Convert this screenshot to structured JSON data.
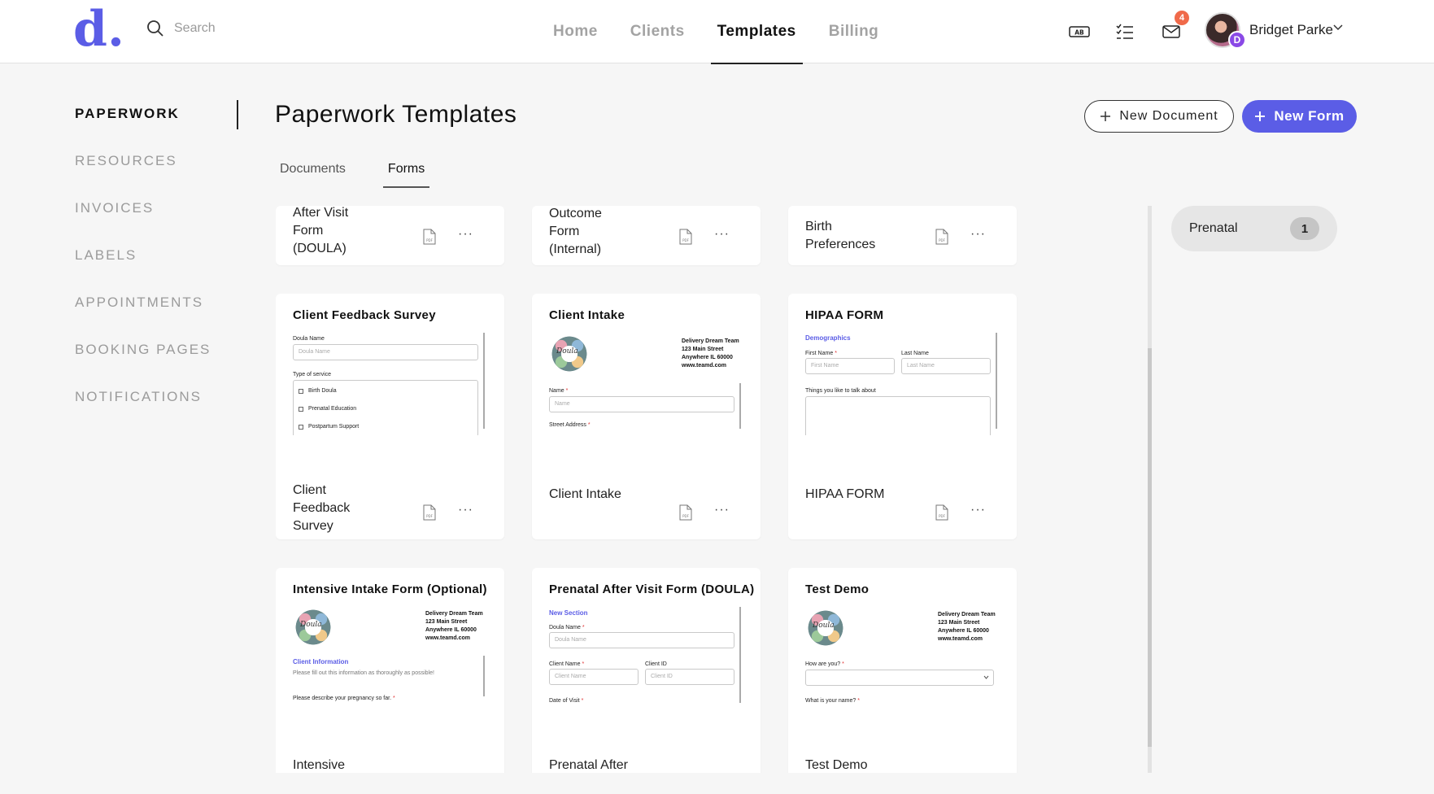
{
  "brand": {
    "logo": "d",
    "logo_dot": ".",
    "accent": "#5b5de6"
  },
  "search": {
    "placeholder": "Search"
  },
  "nav": [
    "Home",
    "Clients",
    "Templates",
    "Billing"
  ],
  "notifications": {
    "count": "4"
  },
  "user": {
    "name": "Bridget Parke",
    "initial": "D"
  },
  "header_icons": {
    "abbr": "AB"
  },
  "sidebar": [
    "PAPERWORK",
    "RESOURCES",
    "INVOICES",
    "LABELS",
    "APPOINTMENTS",
    "BOOKING PAGES",
    "NOTIFICATIONS"
  ],
  "page": {
    "title": "Paperwork Templates",
    "new_document": "New Document",
    "new_form": "New Form"
  },
  "tabs": [
    "Documents",
    "Forms"
  ],
  "cards": {
    "row1": [
      {
        "name": "After Visit\nForm\n(DOULA)"
      },
      {
        "name": "Outcome\nForm\n(Internal)"
      },
      {
        "name": "Birth\nPreferences"
      }
    ],
    "row2": [
      {
        "title": "Client Feedback Survey",
        "name": "Client\nFeedback\nSurvey"
      },
      {
        "title": "Client Intake",
        "name": "Client Intake"
      },
      {
        "title": "HIPAA FORM",
        "name": "HIPAA FORM"
      }
    ],
    "row3": [
      {
        "title": "Intensive Intake Form (Optional)",
        "name": "Intensive\nIntake Form"
      },
      {
        "title": "Prenatal After Visit Form (DOULA)",
        "name": "Prenatal After\nVisit Form"
      },
      {
        "title": "Test Demo",
        "name": "Test Demo"
      }
    ]
  },
  "previews": {
    "feedback": {
      "doula_name_label": "Doula Name",
      "doula_name_ph": "Doula Name",
      "service_label": "Type of service",
      "options": [
        "Birth Doula",
        "Prenatal Education",
        "Postpartum Support"
      ]
    },
    "intake": {
      "address": "Delivery Dream Team\n123 Main Street\nAnywhere IL 60000\nwww.teamd.com",
      "name_label": "Name",
      "name_ph": "Name",
      "street_label": "Street Address"
    },
    "hipaa": {
      "section": "Demographics",
      "first_label": "First Name",
      "last_label": "Last Name",
      "first_ph": "First Name",
      "last_ph": "Last Name",
      "talk_label": "Things you like to talk about"
    },
    "intensive": {
      "address": "Delivery Dream Team\n123 Main Street\nAnywhere IL 60000\nwww.teamd.com",
      "section": "Client Information",
      "note": "Please fill out this information as thoroughly as possible!",
      "question": "Please describe your pregnancy so far."
    },
    "prenatal": {
      "section": "New Section",
      "doula_label": "Doula Name",
      "doula_ph": "Doula Name",
      "client_label": "Client Name",
      "client_ph": "Client Name",
      "id_label": "Client ID",
      "id_ph": "Client ID",
      "date_label": "Date of Visit"
    },
    "demo": {
      "address": "Delivery Dream Team\n123 Main Street\nAnywhere IL 60000\nwww.teamd.com",
      "q1": "How are you?",
      "q2": "What is your name?"
    },
    "logo_text": "Doula"
  },
  "filter": {
    "label": "Prenatal",
    "count": "1"
  },
  "colors": {
    "required": "#e03030",
    "badge": "#f06a4a",
    "avatar_badge": "#8a49e6"
  }
}
